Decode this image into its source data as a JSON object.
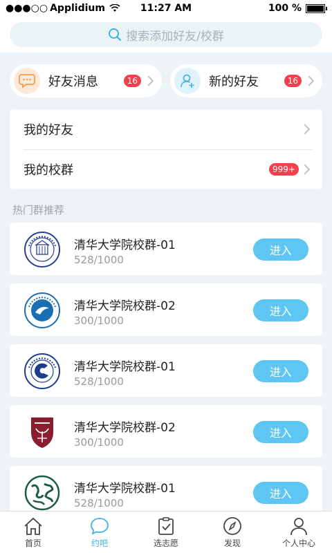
{
  "status_bar": {
    "signal": "●●●○○",
    "carrier": "Applidium",
    "time": "11:27 AM",
    "battery_text": "100 %",
    "battery_level": 1.0
  },
  "search": {
    "placeholder": "搜索添加好友/校群",
    "icon": "search-icon"
  },
  "quick_actions": [
    {
      "label": "好友消息",
      "badge": "16",
      "icon": "chat-bubble-icon",
      "icon_color": "#f59b52",
      "icon_bg": "#fde9d8"
    },
    {
      "label": "新的好友",
      "badge": "16",
      "icon": "add-friend-icon",
      "icon_color": "#4db6e8",
      "icon_bg": "#e0f2fb"
    }
  ],
  "menu": [
    {
      "label": "我的好友",
      "badge": ""
    },
    {
      "label": "我的校群",
      "badge": "999+"
    }
  ],
  "section_title": "热门群推荐",
  "groups": [
    {
      "name": "清华大学院校群-01",
      "count": "528/1000",
      "join": "进入",
      "logo": "university-seal-logo-1"
    },
    {
      "name": "清华大学院校群-02",
      "count": "300/1000",
      "join": "进入",
      "logo": "university-seal-logo-2"
    },
    {
      "name": "清华大学院校群-01",
      "count": "528/1000",
      "join": "进入",
      "logo": "university-seal-logo-3"
    },
    {
      "name": "清华大学院校群-02",
      "count": "300/1000",
      "join": "进入",
      "logo": "university-shield-logo"
    },
    {
      "name": "清华大学院校群-01",
      "count": "528/1000",
      "join": "进入",
      "logo": "calligraphy-logo"
    }
  ],
  "tabs": [
    {
      "label": "首页",
      "icon": "home-icon",
      "active": false
    },
    {
      "label": "约吧",
      "icon": "chat-bubble-icon",
      "active": true
    },
    {
      "label": "选志愿",
      "icon": "clipboard-check-icon",
      "active": false
    },
    {
      "label": "发现",
      "icon": "compass-icon",
      "active": false
    },
    {
      "label": "个人中心",
      "icon": "person-icon",
      "active": false
    }
  ],
  "colors": {
    "accent": "#3db3ea",
    "button": "#5dc6f2",
    "badge": "#f2404c",
    "background": "#edf3f7"
  }
}
